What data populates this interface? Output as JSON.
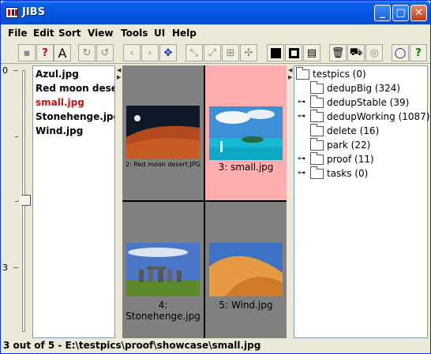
{
  "window": {
    "title": "JIBS"
  },
  "titlebar_buttons": [
    "_",
    "□",
    "✕"
  ],
  "menu": [
    "File",
    "Edit",
    "Sort",
    "View",
    "Tools",
    "UI",
    "Help"
  ],
  "toolbar": {
    "icons": [
      "save-icon",
      "delete-red-icon",
      "font-icon",
      "redo-icon",
      "refresh-icon",
      "arrow-left-icon",
      "arrow-right-icon",
      "rotate-icon",
      "shrink-icon",
      "resize-icon",
      "expand-icon",
      "move-icon",
      "square-filled-icon",
      "square-frame-icon",
      "filmstrip-icon",
      "trash-icon",
      "car-icon",
      "spiral-icon",
      "speech-bubble-icon",
      "help-icon"
    ]
  },
  "slider": {
    "ticks": [
      "0",
      "3"
    ]
  },
  "file_list": [
    {
      "name": "Azul.jpg",
      "color": "#000000"
    },
    {
      "name": "Red moon dese...",
      "color": "#000000"
    },
    {
      "name": "small.jpg",
      "color": "#cc1111"
    },
    {
      "name": "Stonehenge.jpg",
      "color": "#000000"
    },
    {
      "name": "Wind.jpg",
      "color": "#000000"
    }
  ],
  "grid": {
    "cells": [
      {
        "caption": "",
        "selected": false,
        "image": "none"
      },
      {
        "caption": "3: small.jpg",
        "selected": true,
        "image": "beach"
      },
      {
        "caption": "2: Red moon desert.JPG",
        "selected": false,
        "image": "desert"
      },
      {
        "caption": "4: Stonehenge.jpg",
        "selected": false,
        "image": "stonehenge"
      },
      {
        "caption": "5: Wind.jpg",
        "selected": false,
        "image": "dunes"
      }
    ]
  },
  "tree": [
    {
      "label": "testpics (0)",
      "expandable": false,
      "level": 0
    },
    {
      "label": "dedupBig (324)",
      "expandable": false,
      "level": 1
    },
    {
      "label": "dedupStable (39)",
      "expandable": true,
      "level": 1
    },
    {
      "label": "dedupWorking (1087)",
      "expandable": true,
      "level": 1
    },
    {
      "label": "delete (16)",
      "expandable": false,
      "level": 1
    },
    {
      "label": "park (22)",
      "expandable": false,
      "level": 1
    },
    {
      "label": "proof (11)",
      "expandable": true,
      "level": 1
    },
    {
      "label": "tasks (0)",
      "expandable": true,
      "level": 1
    }
  ],
  "status": {
    "text": "3 out of 5 - E:\\testpics\\proof\\showcase\\small.jpg"
  },
  "colors": {
    "selected_cell": "#ffaeb0",
    "cell_bg": "#808080",
    "highlight_file": "#cc1111",
    "titlebar": "#0556e0"
  }
}
